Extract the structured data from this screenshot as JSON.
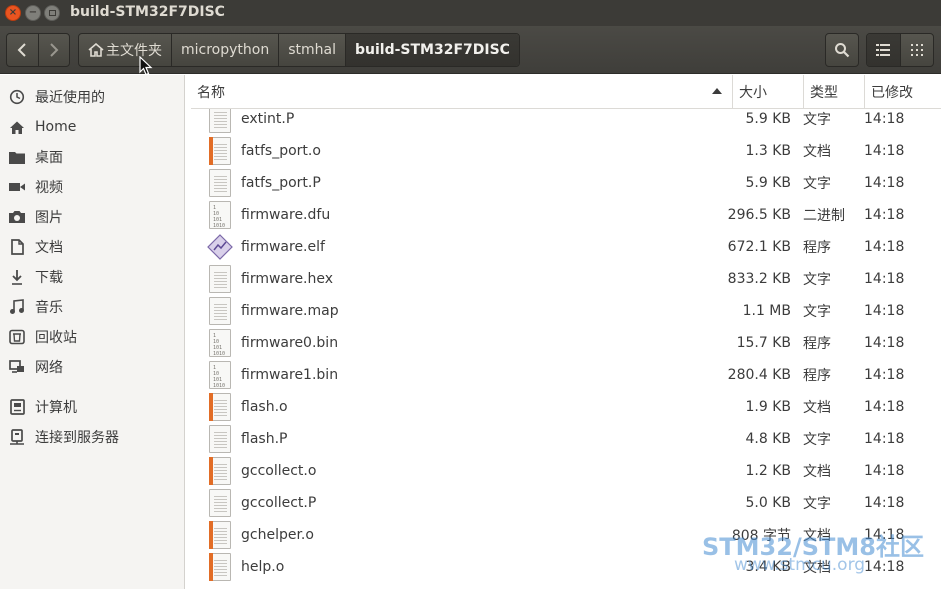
{
  "window": {
    "title": "build-STM32F7DISC"
  },
  "breadcrumbs": [
    {
      "label": "主文件夹",
      "icon": "home-icon"
    },
    {
      "label": "micropython"
    },
    {
      "label": "stmhal"
    },
    {
      "label": "build-STM32F7DISC",
      "active": true
    }
  ],
  "sidebar": {
    "items": [
      {
        "label": "最近使用的",
        "icon": "clock-icon"
      },
      {
        "label": "Home",
        "icon": "home-icon"
      },
      {
        "label": "桌面",
        "icon": "folder-icon"
      },
      {
        "label": "视频",
        "icon": "video-icon"
      },
      {
        "label": "图片",
        "icon": "camera-icon"
      },
      {
        "label": "文档",
        "icon": "document-icon"
      },
      {
        "label": "下载",
        "icon": "download-icon"
      },
      {
        "label": "音乐",
        "icon": "music-icon"
      },
      {
        "label": "回收站",
        "icon": "trash-icon"
      },
      {
        "label": "网络",
        "icon": "network-icon"
      },
      {
        "label": "计算机",
        "icon": "computer-icon"
      },
      {
        "label": "连接到服务器",
        "icon": "server-icon"
      }
    ]
  },
  "columns": {
    "name": "名称",
    "size": "大小",
    "type": "类型",
    "modified": "已修改"
  },
  "files": [
    {
      "name": "extint.P",
      "size": "5.9 KB",
      "type": "文字",
      "modified": "14:18",
      "icon": "text"
    },
    {
      "name": "fatfs_port.o",
      "size": "1.3 KB",
      "type": "文档",
      "modified": "14:18",
      "icon": "obj"
    },
    {
      "name": "fatfs_port.P",
      "size": "5.9 KB",
      "type": "文字",
      "modified": "14:18",
      "icon": "text"
    },
    {
      "name": "firmware.dfu",
      "size": "296.5 KB",
      "type": "二进制",
      "modified": "14:18",
      "icon": "bin"
    },
    {
      "name": "firmware.elf",
      "size": "672.1 KB",
      "type": "程序",
      "modified": "14:18",
      "icon": "elf"
    },
    {
      "name": "firmware.hex",
      "size": "833.2 KB",
      "type": "文字",
      "modified": "14:18",
      "icon": "text"
    },
    {
      "name": "firmware.map",
      "size": "1.1 MB",
      "type": "文字",
      "modified": "14:18",
      "icon": "text"
    },
    {
      "name": "firmware0.bin",
      "size": "15.7 KB",
      "type": "程序",
      "modified": "14:18",
      "icon": "bin"
    },
    {
      "name": "firmware1.bin",
      "size": "280.4 KB",
      "type": "程序",
      "modified": "14:18",
      "icon": "bin"
    },
    {
      "name": "flash.o",
      "size": "1.9 KB",
      "type": "文档",
      "modified": "14:18",
      "icon": "obj"
    },
    {
      "name": "flash.P",
      "size": "4.8 KB",
      "type": "文字",
      "modified": "14:18",
      "icon": "text"
    },
    {
      "name": "gccollect.o",
      "size": "1.2 KB",
      "type": "文档",
      "modified": "14:18",
      "icon": "obj"
    },
    {
      "name": "gccollect.P",
      "size": "5.0 KB",
      "type": "文字",
      "modified": "14:18",
      "icon": "text"
    },
    {
      "name": "gchelper.o",
      "size": "808 字节",
      "type": "文档",
      "modified": "14:18",
      "icon": "obj"
    },
    {
      "name": "help.o",
      "size": "3.4 KB",
      "type": "文档",
      "modified": "14:18",
      "icon": "obj"
    }
  ],
  "watermark": {
    "line1": "STM32/STM8社区",
    "line2": "www.stmcu.org"
  },
  "colors": {
    "titlebar": "#3c3b37",
    "toolbar": "#46453f",
    "close_button": "#e95420",
    "sidebar": "#f5f4f2",
    "object_file_accent": "#e26d26"
  }
}
